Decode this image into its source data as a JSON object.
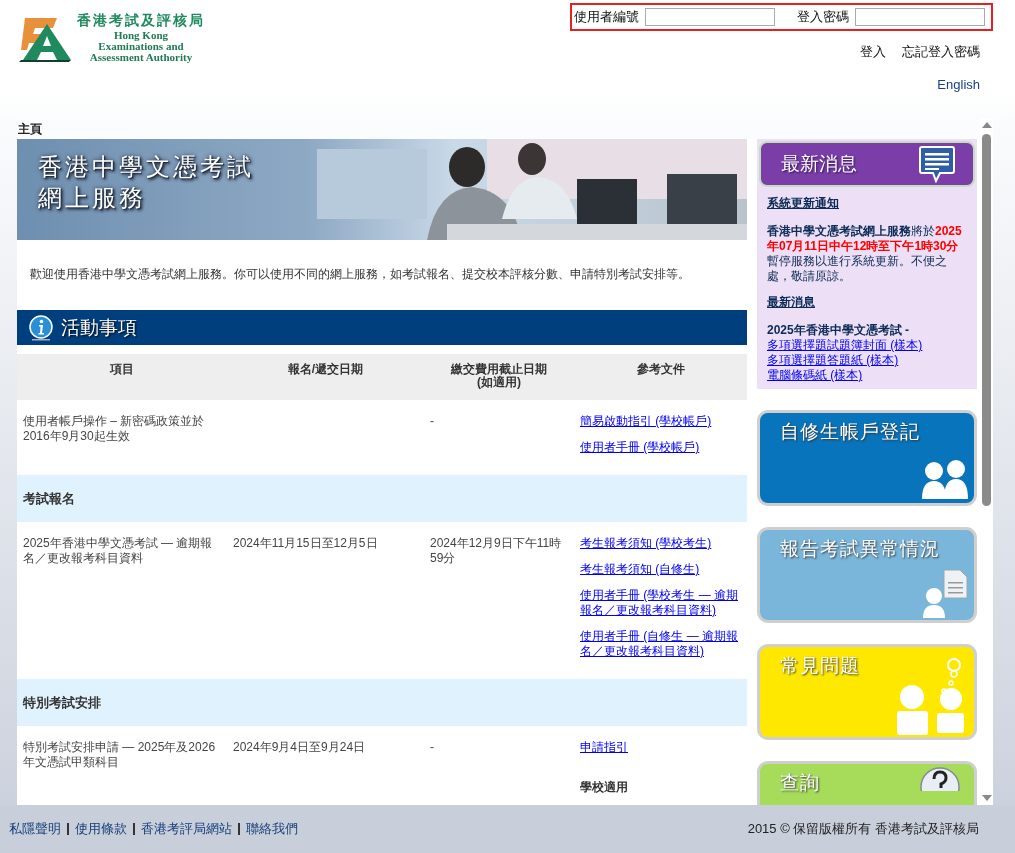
{
  "header": {
    "logo": {
      "chinese": "香港考試及評核局",
      "english": [
        "Hong Kong",
        "Examinations and",
        "Assessment Authority"
      ]
    },
    "login": {
      "username_label": "使用者編號",
      "password_label": "登入密碼",
      "login_link": "登入",
      "forgot_link": "忘記登入密碼"
    },
    "language_link": "English"
  },
  "breadcrumb": "主頁",
  "banner": {
    "title_lines": [
      "香港中學文憑考試",
      "網上服務"
    ]
  },
  "intro": "歡迎使用香港中學文憑考試網上服務。你可以使用不同的網上服務，如考試報名、提交校本評核分數、申請特別考試安排等。",
  "activities": {
    "title": "活動事項",
    "columns": [
      {
        "lines": [
          "項目"
        ]
      },
      {
        "lines": [
          "報名/遞交日期"
        ]
      },
      {
        "lines": [
          "繳交費用截止日期",
          "(如適用)"
        ]
      },
      {
        "lines": [
          "參考文件"
        ]
      }
    ],
    "rows": [
      {
        "kind": "item",
        "item": "使用者帳戶操作 – 新密碼政策並於2016年9月30起生效",
        "dates": "",
        "fee_deadline": "-",
        "documents": [
          {
            "kind": "link",
            "text": "簡易啟動指引 (學校帳戶)"
          },
          {
            "kind": "link",
            "text": "使用者手冊 (學校帳戶)"
          }
        ]
      },
      {
        "kind": "section",
        "title": "考試報名"
      },
      {
        "kind": "item",
        "item": "2025年香港中學文憑考試 — 逾期報名／更改報考科目資料",
        "dates": "2024年11月15日至12月5日",
        "fee_deadline": "2024年12月9日下午11時59分",
        "documents": [
          {
            "kind": "link",
            "text": "考生報考須知 (學校考生)"
          },
          {
            "kind": "link",
            "text": "考生報考須知 (自修生)"
          },
          {
            "kind": "link",
            "text": "使用者手冊 (學校考生 — 逾期報名／更改報考科目資料)"
          },
          {
            "kind": "link",
            "text": "使用者手冊 (自修生 — 逾期報名／更改報考科目資料)"
          }
        ]
      },
      {
        "kind": "section",
        "title": "特別考試安排"
      },
      {
        "kind": "item",
        "item": "特別考試安排申請 — 2025年及2026年文憑試甲類科目",
        "dates": "2024年9月4日至9月24日",
        "fee_deadline": "-",
        "documents": [
          {
            "kind": "link",
            "text": "申請指引"
          },
          {
            "kind": "label",
            "text": "學校適用"
          }
        ]
      }
    ]
  },
  "news": {
    "title": "最新消息",
    "sections": [
      {
        "heading": "系統更新通知",
        "kind": "notice",
        "segments": [
          {
            "kind": "strong",
            "text": "香港中學文憑考試網上服務"
          },
          {
            "kind": "plain",
            "text": "將於"
          },
          {
            "kind": "alert",
            "text": "2025年07月11日中午12時至下午1時30分"
          },
          {
            "kind": "plain",
            "text": "暫停服務以進行系統更新。不便之處，敬請原諒。"
          }
        ]
      },
      {
        "heading": "最新消息",
        "kind": "links",
        "lead": "2025年香港中學文憑考試 -",
        "links": [
          {
            "text": "多項選擇題試題簿封面",
            "note": "(樣本)"
          },
          {
            "text": "多項選擇題答題紙",
            "note": "(樣本)"
          },
          {
            "text": "電腦條碼紙",
            "note": "(樣本)"
          }
        ]
      }
    ]
  },
  "tiles": [
    {
      "kind": "register",
      "title": "自修生帳戶登記",
      "color": "#0874bb"
    },
    {
      "kind": "report",
      "title": "報告考試異常情況",
      "color": "#7ab5da"
    },
    {
      "kind": "faq",
      "title": "常見問題",
      "color": "#ffe800"
    },
    {
      "kind": "enquiry",
      "title": "查詢",
      "color": "#a6dc5a"
    }
  ],
  "footer": {
    "links": [
      "私隱聲明",
      "使用條款",
      "香港考評局網站",
      "聯絡我們"
    ],
    "copyright": "2015 © 保留版權所有 香港考試及評核局"
  }
}
